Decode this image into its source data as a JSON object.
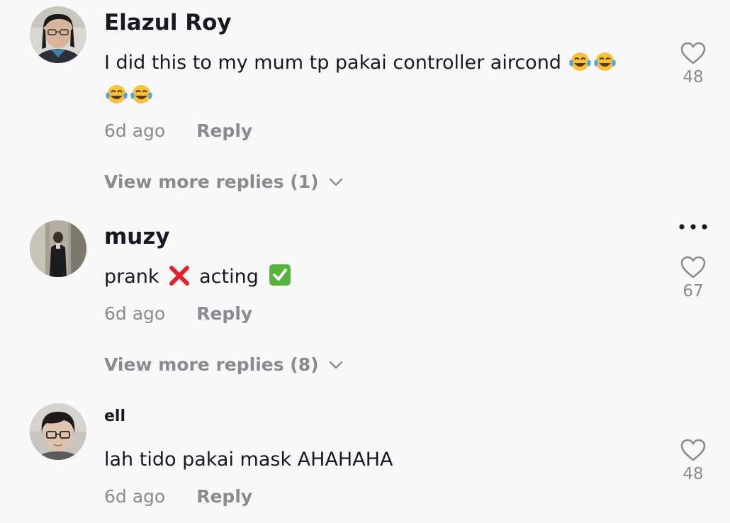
{
  "comments": [
    {
      "username": "Elazul Roy",
      "text": "I did this to my mum tp pakai controller aircond",
      "emojis": [
        "😂",
        "😂",
        "😂",
        "😂"
      ],
      "time": "6d ago",
      "reply_label": "Reply",
      "likes": "48",
      "view_more": "View more replies (1)"
    },
    {
      "username": "muzy",
      "text_part1": "prank",
      "text_part2": "acting",
      "emoji_cross": "❌",
      "emoji_check": "✅",
      "time": "6d ago",
      "reply_label": "Reply",
      "likes": "67",
      "view_more": "View more replies (8)"
    },
    {
      "username": "ell",
      "text": "lah tido pakai mask AHAHAHA",
      "time": "6d ago",
      "reply_label": "Reply",
      "likes": "48"
    }
  ],
  "icons": {
    "like": "heart-outline-icon",
    "expand": "chevron-down-icon",
    "more": "more-options-icon"
  },
  "colors": {
    "background": "#f8f8f8",
    "primary_text": "#161823",
    "secondary_text": "#8a8b91"
  }
}
